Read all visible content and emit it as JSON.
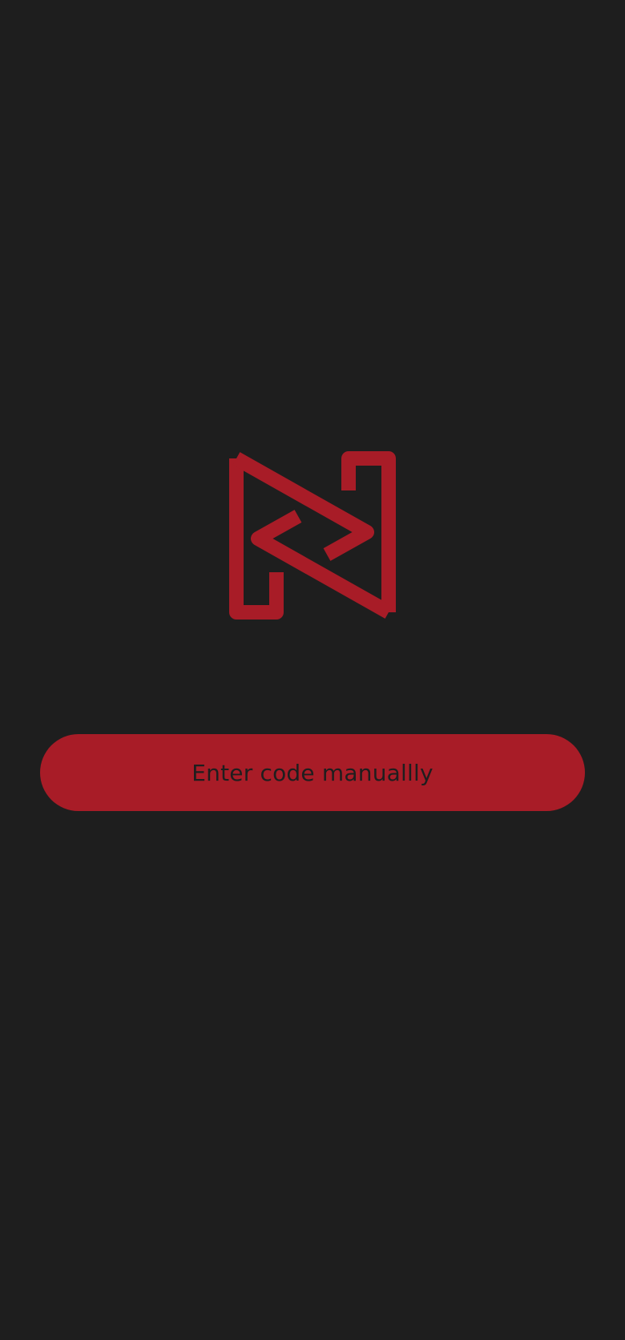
{
  "colors": {
    "background": "#1e1e1e",
    "brand": "#a81c27",
    "button_text": "#1e1e1e"
  },
  "logo": {
    "icon": "n-monogram-logo-icon"
  },
  "manual_entry": {
    "label": "Enter code manuallly"
  }
}
